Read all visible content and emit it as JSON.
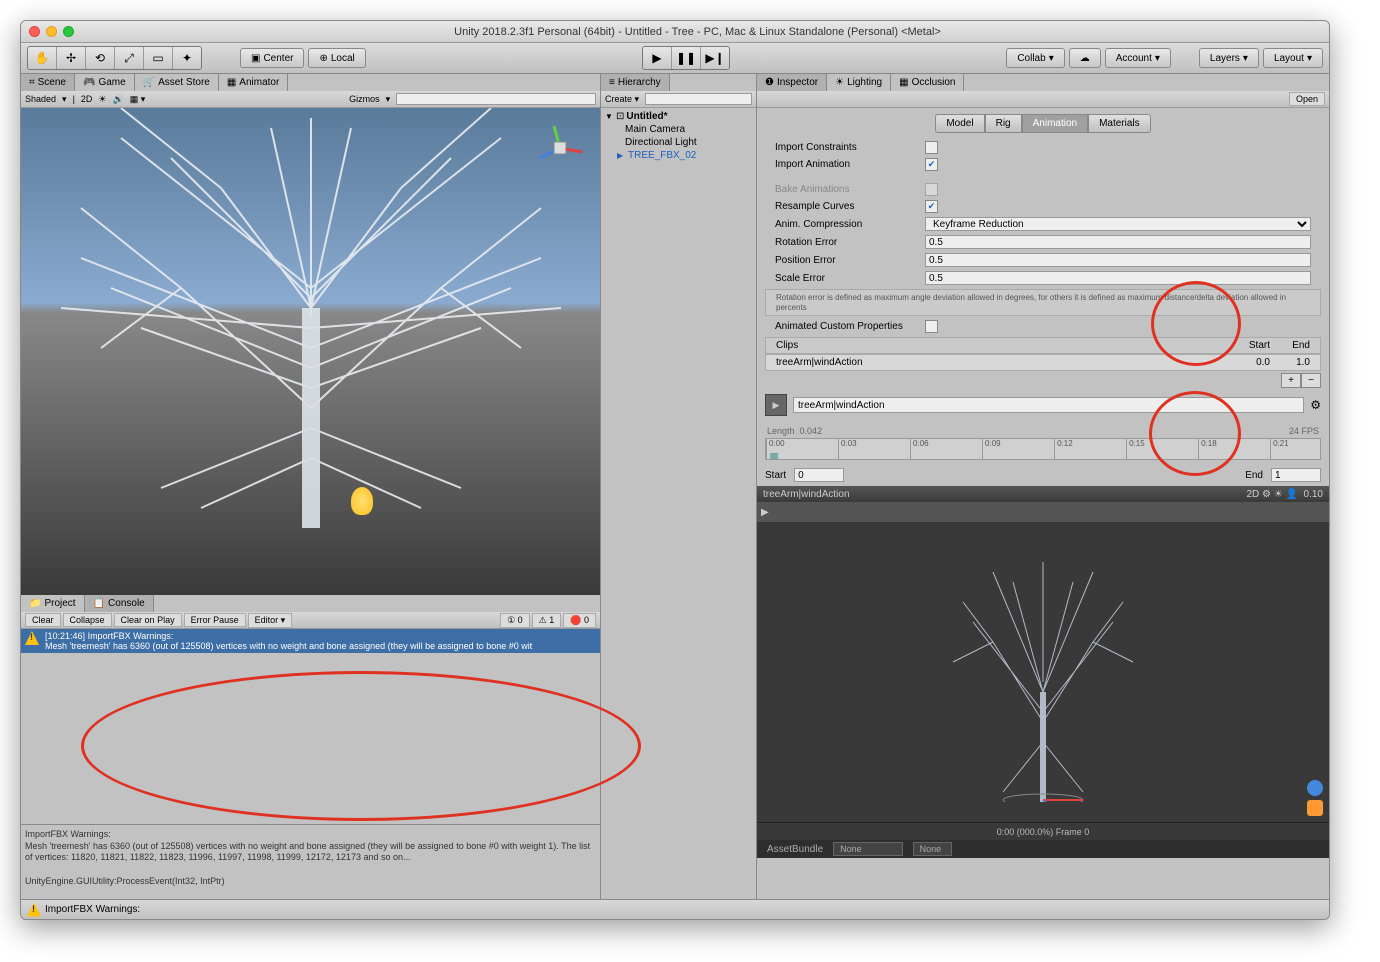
{
  "window": {
    "title": "Unity 2018.2.3f1 Personal (64bit) - Untitled - Tree - PC, Mac & Linux Standalone (Personal) <Metal>"
  },
  "toolbar": {
    "center": "Center",
    "local": "Local",
    "collab": "Collab",
    "account": "Account",
    "layers": "Layers",
    "layout": "Layout"
  },
  "sceneTabs": {
    "scene": "Scene",
    "game": "Game",
    "assetStore": "Asset Store",
    "animator": "Animator"
  },
  "sceneBar": {
    "shaded": "Shaded",
    "twod": "2D",
    "gizmos": "Gizmos"
  },
  "projectTabs": {
    "project": "Project",
    "console": "Console"
  },
  "consoleBar": {
    "clear": "Clear",
    "collapse": "Collapse",
    "clearOnPlay": "Clear on Play",
    "errorPause": "Error Pause",
    "editor": "Editor",
    "count0": "0",
    "count1": "1",
    "count2": "0"
  },
  "console": {
    "logTime": "[10:21:46]",
    "logTitle": "ImportFBX Warnings:",
    "logMsg": "Mesh 'treemesh' has 6360 (out of 125508) vertices with no weight and bone assigned (they will be assigned to bone #0 wit",
    "detailTitle": "ImportFBX Warnings:",
    "detail1": "Mesh 'treemesh' has 6360 (out of 125508) vertices with no weight and bone assigned (they will be assigned to bone #0 with weight 1). The list of vertices: 11820, 11821, 11822, 11823, 11996, 11997, 11998, 11999, 12172, 12173 and so on...",
    "detail2": "UnityEngine.GUIUtility:ProcessEvent(Int32, IntPtr)"
  },
  "statusBar": {
    "text": "ImportFBX Warnings:"
  },
  "hierarchy": {
    "tab": "Hierarchy",
    "create": "Create",
    "scene": "Untitled*",
    "items": [
      "Main Camera",
      "Directional Light",
      "TREE_FBX_02"
    ]
  },
  "inspector": {
    "tabs": {
      "inspector": "Inspector",
      "lighting": "Lighting",
      "occlusion": "Occlusion"
    },
    "open": "Open",
    "modelTabs": {
      "model": "Model",
      "rig": "Rig",
      "animation": "Animation",
      "materials": "Materials"
    },
    "props": {
      "importConstraints": "Import Constraints",
      "importAnimation": "Import Animation",
      "bakeAnimations": "Bake Animations",
      "resampleCurves": "Resample Curves",
      "animCompression": "Anim. Compression",
      "animCompressionVal": "Keyframe Reduction",
      "rotationError": "Rotation Error",
      "rotationErrorVal": "0.5",
      "positionError": "Position Error",
      "positionErrorVal": "0.5",
      "scaleError": "Scale Error",
      "scaleErrorVal": "0.5",
      "helpText": "Rotation error is defined as maximum angle deviation allowed in degrees, for others it is defined as maximum distance/delta deviation allowed in percents",
      "animatedCustom": "Animated Custom Properties"
    },
    "clips": {
      "header": "Clips",
      "start": "Start",
      "end": "End",
      "name": "treeArm|windAction",
      "startVal": "0.0",
      "endVal": "1.0"
    },
    "clipEdit": {
      "name": "treeArm|windAction",
      "length": "Length",
      "lengthVal": "0.042",
      "fps": "24 FPS",
      "ticks": [
        "0:00",
        "0:03",
        "0:06",
        "0:09",
        "0:12",
        "0:15",
        "0:18",
        "0:21"
      ],
      "startLabel": "Start",
      "startVal": "0",
      "endLabel": "End",
      "endVal": "1"
    },
    "preview": {
      "title": "treeArm|windAction",
      "twod": "2D",
      "zoom": "0.10",
      "footer": "0:00 (000.0%) Frame 0"
    },
    "assetBundle": {
      "label": "AssetBundle",
      "none1": "None",
      "none2": "None"
    }
  }
}
